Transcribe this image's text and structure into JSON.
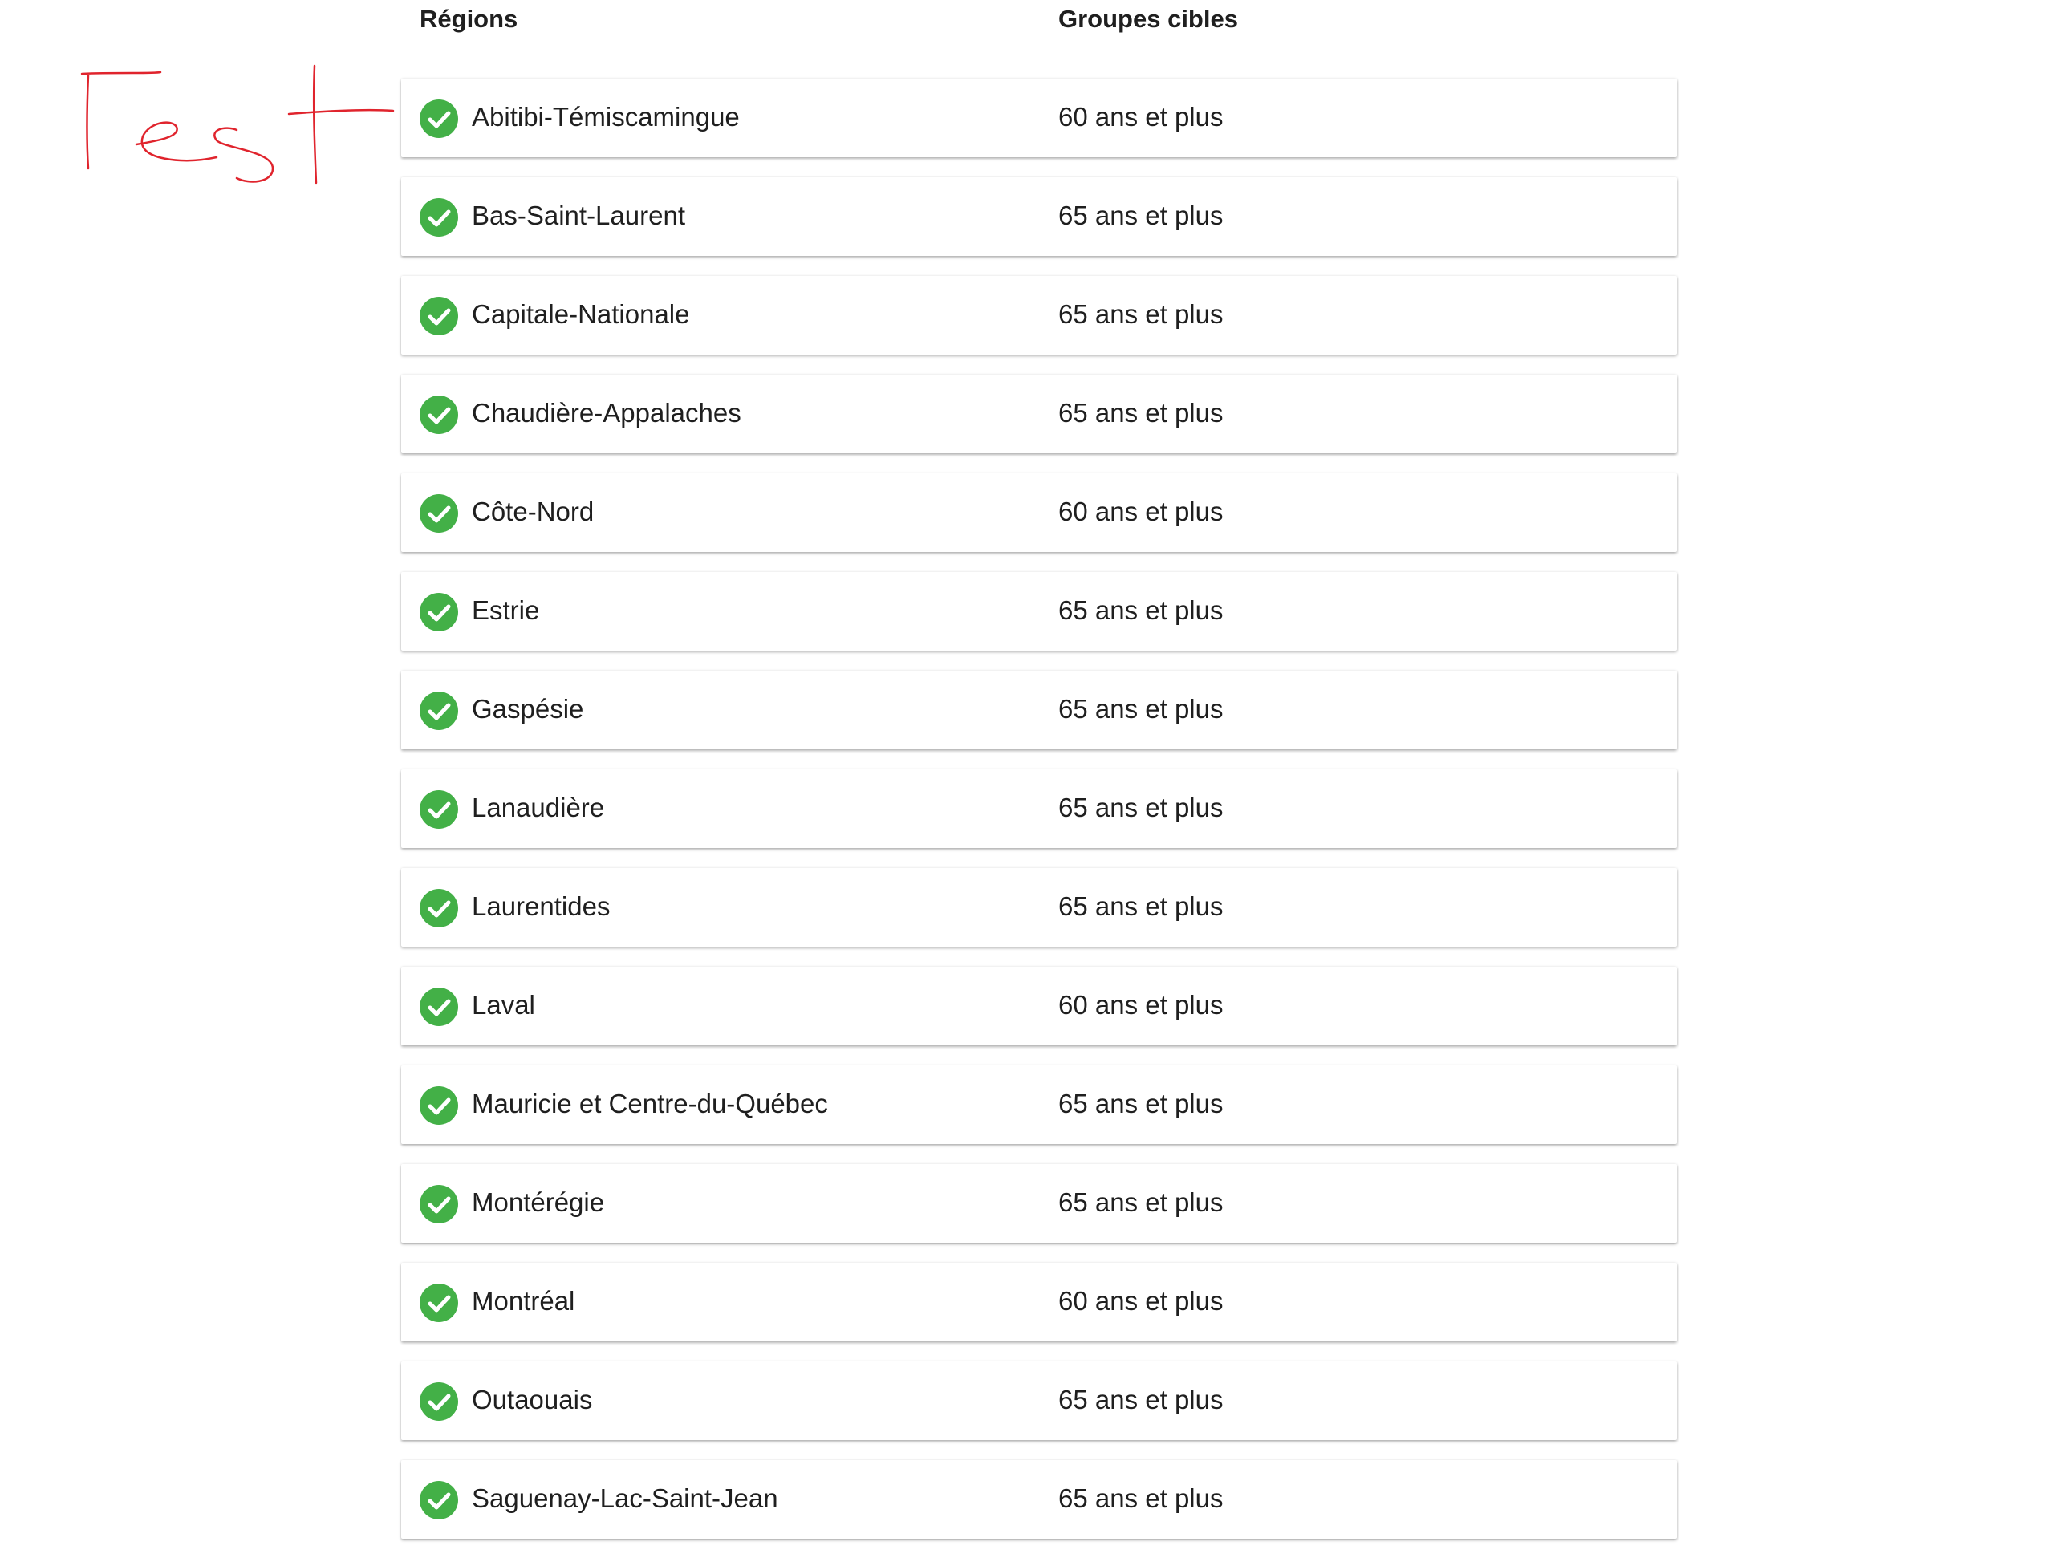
{
  "table": {
    "headers": {
      "region": "Régions",
      "group": "Groupes cibles"
    },
    "rows": [
      {
        "region": "Abitibi-Témiscamingue",
        "group": "60 ans et plus"
      },
      {
        "region": "Bas-Saint-Laurent",
        "group": "65 ans et plus"
      },
      {
        "region": "Capitale-Nationale",
        "group": "65 ans et plus"
      },
      {
        "region": "Chaudière-Appalaches",
        "group": "65 ans et plus"
      },
      {
        "region": "Côte-Nord",
        "group": "60 ans et plus"
      },
      {
        "region": "Estrie",
        "group": "65 ans et plus"
      },
      {
        "region": "Gaspésie",
        "group": "65 ans et plus"
      },
      {
        "region": "Lanaudière",
        "group": "65 ans et plus"
      },
      {
        "region": "Laurentides",
        "group": "65 ans et plus"
      },
      {
        "region": "Laval",
        "group": "60 ans et plus"
      },
      {
        "region": "Mauricie et Centre-du-Québec",
        "group": "65 ans et plus"
      },
      {
        "region": "Montérégie",
        "group": "65 ans et plus"
      },
      {
        "region": "Montréal",
        "group": "60 ans et plus"
      },
      {
        "region": "Outaouais",
        "group": "65 ans et plus"
      },
      {
        "region": "Saguenay-Lac-Saint-Jean",
        "group": "65 ans et plus"
      }
    ]
  },
  "row_icon": "check-circle-icon",
  "annotation": {
    "text": "Test",
    "color": "#e0242d"
  },
  "colors": {
    "check": "#43b047",
    "text": "#1f1f1f"
  }
}
